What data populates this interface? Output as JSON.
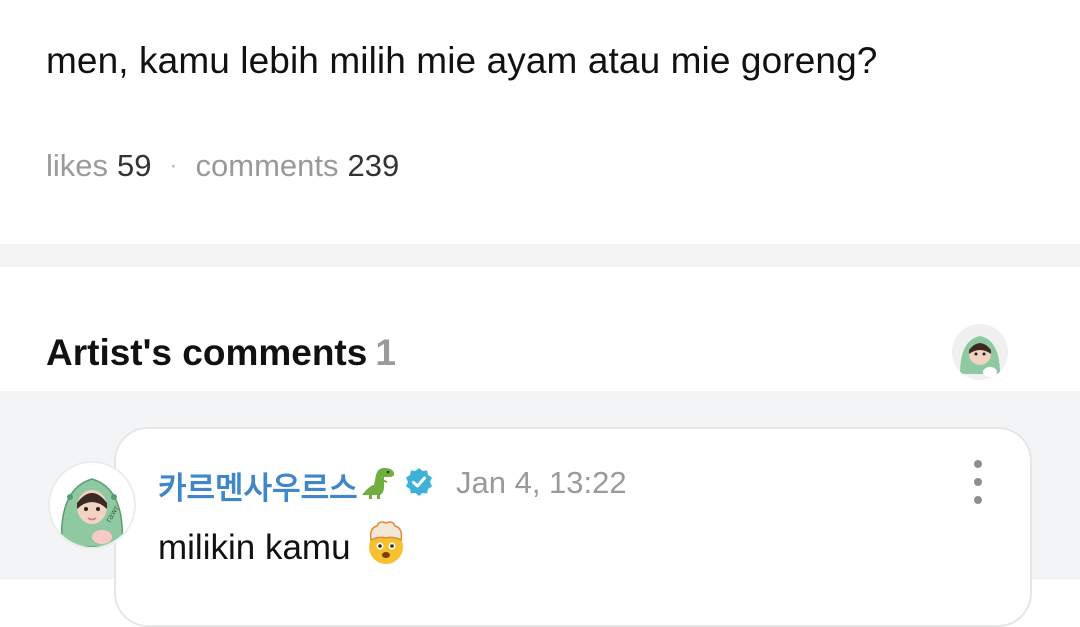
{
  "post": {
    "text": "men, kamu lebih milih mie ayam atau mie goreng?",
    "likes_label": "likes",
    "likes_count": "59",
    "separator": "·",
    "comments_label": "comments",
    "comments_count": "239"
  },
  "artist_comments": {
    "title": "Artist's comments",
    "count": "1",
    "comments": [
      {
        "author": "카르멘사우르스",
        "date": "Jan 4, 13:22",
        "text": "milikin kamu",
        "author_icons": [
          "dinosaur-emoji-icon",
          "verified-badge-icon"
        ],
        "text_icon": "exploding-head-emoji-icon"
      }
    ]
  },
  "colors": {
    "author": "#3f87c8",
    "verified": "#3db2d6",
    "muted": "#9a9a9a",
    "section_bg": "#f3f4f6"
  }
}
